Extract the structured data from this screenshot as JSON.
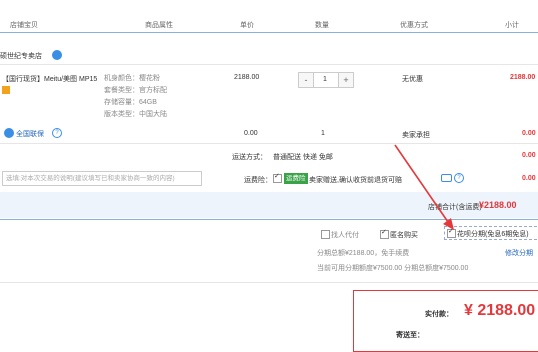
{
  "header": {
    "col_shop": "店铺宝贝",
    "col_attr": "商品属性",
    "col_price": "单价",
    "col_qty": "数量",
    "col_promo": "优惠方式",
    "col_subtotal": "小计"
  },
  "shop": {
    "name": "硕世纪专卖店"
  },
  "product": {
    "title": "【国行现货】Meitu/美图 MP15",
    "attrs": [
      "机身颜色：樱花粉",
      "套餐类型：官方标配",
      "存储容量：64GB",
      "版本类型：中国大陆"
    ],
    "price": "2188.00",
    "qty": "1",
    "qty_minus": "-",
    "qty_plus": "+",
    "promo": "无优惠",
    "subtotal": "2188.00"
  },
  "service": {
    "name": "全国联保",
    "price": "0.00",
    "qty": "1",
    "promo": "卖家承担",
    "subtotal": "0.00"
  },
  "shipping": {
    "label": "运送方式：",
    "value": "普通配送 快递 免邮",
    "amount": "0.00"
  },
  "message": {
    "placeholder": "选填:对本次交易的说明(建议填写已和卖家协商一致的内容)"
  },
  "insurance": {
    "label": "运费险：",
    "badge": "运费险",
    "text": "卖家赠送,确认收货前退货可赔",
    "amount": "0.00"
  },
  "summary": {
    "label": "店铺合计(含运费)",
    "amount": "¥2188.00"
  },
  "options": {
    "opt1": "找人代付",
    "opt2": "匿名购买",
    "opt3": "花呗分期(免息6期免息)"
  },
  "installment": {
    "line1": "分期总额¥2188.00，免手续费",
    "line2": "当前可用分期额度¥7500.00 分期总额度¥7500.00",
    "link": "修改分期"
  },
  "payment": {
    "label": "实付款：",
    "amount": "¥ 2188.00",
    "address_label": "寄送至："
  },
  "colors": {
    "accent": "#e4393c",
    "link": "#2266bb",
    "band": "#eef4fb"
  }
}
